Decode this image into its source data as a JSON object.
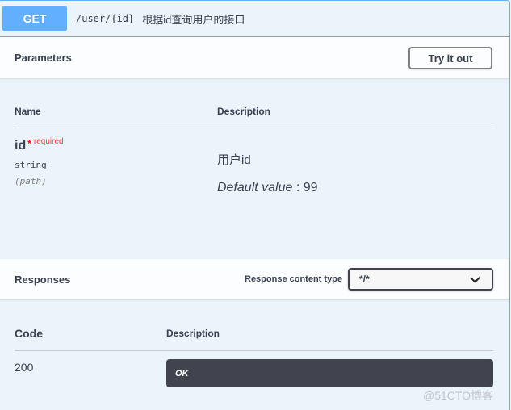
{
  "operation": {
    "method": "GET",
    "path": "/user/{id}",
    "summary": "根据id查询用户的接口",
    "accent_color": "#61affe"
  },
  "parameters_section": {
    "title": "Parameters",
    "try_it_out_label": "Try it out",
    "columns": {
      "name": "Name",
      "description": "Description"
    },
    "params": [
      {
        "name": "id",
        "star": "*",
        "required_label": "required",
        "type": "string",
        "in": "(path)",
        "description": "用户id",
        "default_label": "Default value",
        "default_sep": " : ",
        "default_value": "99"
      }
    ]
  },
  "responses_section": {
    "title": "Responses",
    "content_type_label": "Response content type",
    "content_type_selected": "*/*",
    "columns": {
      "code": "Code",
      "description": "Description"
    },
    "responses": [
      {
        "code": "200",
        "description": "OK"
      }
    ]
  },
  "watermark": "@51CTO博客"
}
